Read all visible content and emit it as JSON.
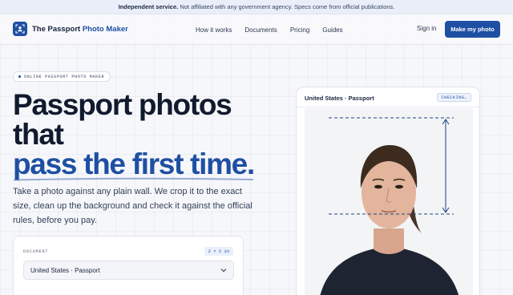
{
  "notice": {
    "strong": "Independent service.",
    "text": " Not affiliated with any government agency. Specs come from official publications."
  },
  "brand": {
    "name": "The Passport",
    "accent": "Photo Maker",
    "color": "#1e4fa3"
  },
  "nav": {
    "links": [
      "How it works",
      "Documents",
      "Pricing",
      "Guides"
    ],
    "signin": "Sign in",
    "cta": "Make my photo"
  },
  "hero": {
    "badge": "ONLINE PASSPORT PHOTO MAKER",
    "headline_line1": "Passport photos",
    "headline_line2": "that",
    "headline_accent": "pass the first time.",
    "description": "Take a photo against any plain wall. We crop it to the exact size, clean up the background and check it against the official rules, before you pay."
  },
  "document_picker": {
    "label": "DOCUMENT",
    "size": "2 × 2 in",
    "selected": "United States · Passport"
  },
  "preview": {
    "title": "United States · Passport",
    "status": "CHECKING…"
  }
}
